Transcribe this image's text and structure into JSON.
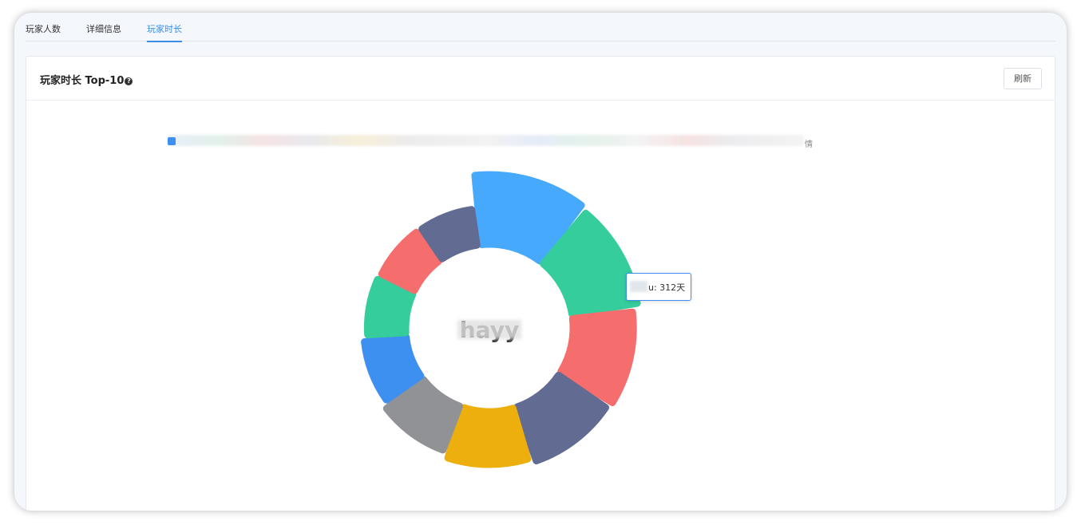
{
  "tabs": [
    {
      "label": "玩家人数",
      "active": false
    },
    {
      "label": "详细信息",
      "active": false
    },
    {
      "label": "玩家时长",
      "active": true
    }
  ],
  "card": {
    "title": "玩家时长 Top-10",
    "refresh_label": "刷新"
  },
  "legend": {
    "tail_text": "情"
  },
  "center_label": "hayy",
  "tooltip": {
    "text": "u: 312天"
  },
  "chart_data": {
    "type": "pie",
    "variant": "rose-donut",
    "title": "",
    "slices": [
      {
        "label": "",
        "value": 312,
        "color": "#47a9fc"
      },
      {
        "label": "",
        "value": 300,
        "color": "#35cd9c"
      },
      {
        "label": "",
        "value": 280,
        "color": "#f56d6c"
      },
      {
        "label": "",
        "value": 270,
        "color": "#626b92"
      },
      {
        "label": "",
        "value": 255,
        "color": "#ecaf0e"
      },
      {
        "label": "",
        "value": 235,
        "color": "#909296"
      },
      {
        "label": "",
        "value": 218,
        "color": "#3d8ff0"
      },
      {
        "label": "",
        "value": 205,
        "color": "#35cd9c"
      },
      {
        "label": "",
        "value": 200,
        "color": "#f56d6c"
      },
      {
        "label": "",
        "value": 198,
        "color": "#626b92"
      }
    ],
    "value_unit": "天"
  },
  "icons": {
    "help": "question-circle-icon",
    "legend": "legend-marker-icon"
  },
  "colors": {
    "accent": "#3a8ee6",
    "primary_blue": "#3d8ff0"
  }
}
